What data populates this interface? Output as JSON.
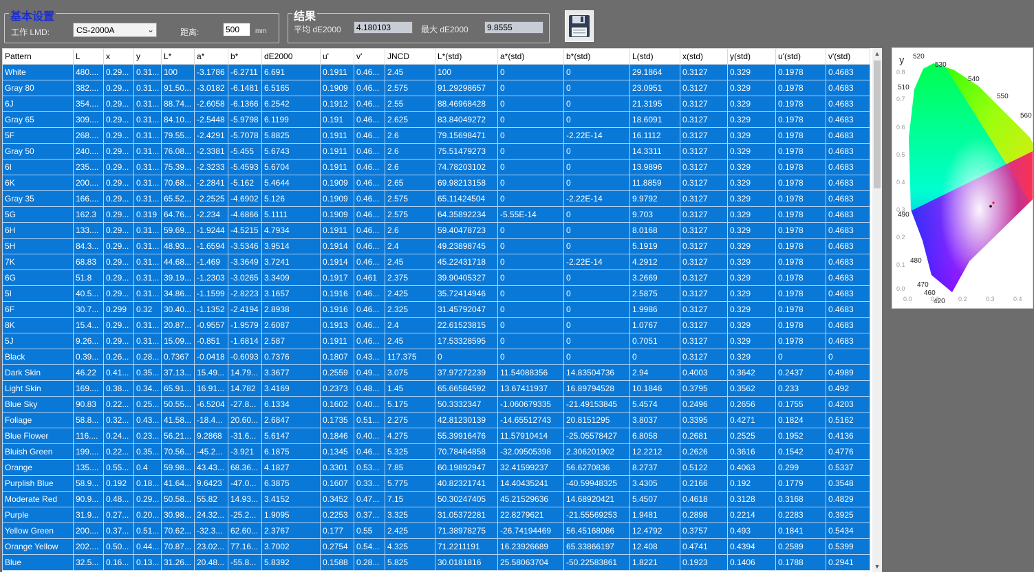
{
  "settings": {
    "title": "基本设置",
    "lmd_label": "工作 LMD:",
    "lmd_value": "CS-2000A",
    "distance_label": "距离:",
    "distance_value": "500",
    "distance_unit": "mm"
  },
  "results": {
    "title": "结果",
    "avg_label": "平均 dE2000",
    "avg_value": "4.180103",
    "max_label": "最大 dE2000",
    "max_value": "9.8555"
  },
  "toolbar": {
    "save_icon": "floppy-disk-icon"
  },
  "colors": {
    "accent_title": "#1c2fd0",
    "row_bg": "#0a78d7",
    "window_bg": "#6d6d6d"
  },
  "table": {
    "columns": [
      "Pattern",
      "L",
      "x",
      "y",
      "L*",
      "a*",
      "b*",
      "dE2000",
      "u'",
      "v'",
      "JNCD",
      "L*(std)",
      "a*(std)",
      "b*(std)",
      "L(std)",
      "x(std)",
      "y(std)",
      "u'(std)",
      "v'(std)"
    ],
    "rows": [
      [
        "White",
        "480....",
        "0.29...",
        "0.31...",
        "100",
        "-3.1786",
        "-6.2711",
        "6.691",
        "0.1911",
        "0.46...",
        "2.45",
        "100",
        "0",
        "0",
        "29.1864",
        "0.3127",
        "0.329",
        "0.1978",
        "0.4683"
      ],
      [
        "Gray 80",
        "382....",
        "0.29...",
        "0.31...",
        "91.50...",
        "-3.0182",
        "-6.1481",
        "6.5165",
        "0.1909",
        "0.46...",
        "2.575",
        "91.29298657",
        "0",
        "0",
        "23.0951",
        "0.3127",
        "0.329",
        "0.1978",
        "0.4683"
      ],
      [
        "6J",
        "354....",
        "0.29...",
        "0.31...",
        "88.74...",
        "-2.6058",
        "-6.1366",
        "6.2542",
        "0.1912",
        "0.46...",
        "2.55",
        "88.46968428",
        "0",
        "0",
        "21.3195",
        "0.3127",
        "0.329",
        "0.1978",
        "0.4683"
      ],
      [
        "Gray 65",
        "309....",
        "0.29...",
        "0.31...",
        "84.10...",
        "-2.5448",
        "-5.9798",
        "6.1199",
        "0.191",
        "0.46...",
        "2.625",
        "83.84049272",
        "0",
        "0",
        "18.6091",
        "0.3127",
        "0.329",
        "0.1978",
        "0.4683"
      ],
      [
        "5F",
        "268....",
        "0.29...",
        "0.31...",
        "79.55...",
        "-2.4291",
        "-5.7078",
        "5.8825",
        "0.1911",
        "0.46...",
        "2.6",
        "79.15698471",
        "0",
        "-2.22E-14",
        "16.1112",
        "0.3127",
        "0.329",
        "0.1978",
        "0.4683"
      ],
      [
        "Gray 50",
        "240....",
        "0.29...",
        "0.31...",
        "76.08...",
        "-2.3381",
        "-5.455",
        "5.6743",
        "0.1911",
        "0.46...",
        "2.6",
        "75.51479273",
        "0",
        "0",
        "14.3311",
        "0.3127",
        "0.329",
        "0.1978",
        "0.4683"
      ],
      [
        "6I",
        "235....",
        "0.29...",
        "0.31...",
        "75.39...",
        "-2.3233",
        "-5.4593",
        "5.6704",
        "0.1911",
        "0.46...",
        "2.6",
        "74.78203102",
        "0",
        "0",
        "13.9896",
        "0.3127",
        "0.329",
        "0.1978",
        "0.4683"
      ],
      [
        "6K",
        "200....",
        "0.29...",
        "0.31...",
        "70.68...",
        "-2.2841",
        "-5.162",
        "5.4644",
        "0.1909",
        "0.46...",
        "2.65",
        "69.98213158",
        "0",
        "0",
        "11.8859",
        "0.3127",
        "0.329",
        "0.1978",
        "0.4683"
      ],
      [
        "Gray 35",
        "166....",
        "0.29...",
        "0.31...",
        "65.52...",
        "-2.2525",
        "-4.6902",
        "5.126",
        "0.1909",
        "0.46...",
        "2.575",
        "65.11424504",
        "0",
        "-2.22E-14",
        "9.9792",
        "0.3127",
        "0.329",
        "0.1978",
        "0.4683"
      ],
      [
        "5G",
        "162.3",
        "0.29...",
        "0.319",
        "64.76...",
        "-2.234",
        "-4.6866",
        "5.1111",
        "0.1909",
        "0.46...",
        "2.575",
        "64.35892234",
        "-5.55E-14",
        "0",
        "9.703",
        "0.3127",
        "0.329",
        "0.1978",
        "0.4683"
      ],
      [
        "6H",
        "133....",
        "0.29...",
        "0.31...",
        "59.69...",
        "-1.9244",
        "-4.5215",
        "4.7934",
        "0.1911",
        "0.46...",
        "2.6",
        "59.40478723",
        "0",
        "0",
        "8.0168",
        "0.3127",
        "0.329",
        "0.1978",
        "0.4683"
      ],
      [
        "5H",
        "84.3...",
        "0.29...",
        "0.31...",
        "48.93...",
        "-1.6594",
        "-3.5346",
        "3.9514",
        "0.1914",
        "0.46...",
        "2.4",
        "49.23898745",
        "0",
        "0",
        "5.1919",
        "0.3127",
        "0.329",
        "0.1978",
        "0.4683"
      ],
      [
        "7K",
        "68.83",
        "0.29...",
        "0.31...",
        "44.68...",
        "-1.469",
        "-3.3649",
        "3.7241",
        "0.1914",
        "0.46...",
        "2.45",
        "45.22431718",
        "0",
        "-2.22E-14",
        "4.2912",
        "0.3127",
        "0.329",
        "0.1978",
        "0.4683"
      ],
      [
        "6G",
        "51.8",
        "0.29...",
        "0.31...",
        "39.19...",
        "-1.2303",
        "-3.0265",
        "3.3409",
        "0.1917",
        "0.461",
        "2.375",
        "39.90405327",
        "0",
        "0",
        "3.2669",
        "0.3127",
        "0.329",
        "0.1978",
        "0.4683"
      ],
      [
        "5I",
        "40.5...",
        "0.29...",
        "0.31...",
        "34.86...",
        "-1.1599",
        "-2.8223",
        "3.1657",
        "0.1916",
        "0.46...",
        "2.425",
        "35.72414946",
        "0",
        "0",
        "2.5875",
        "0.3127",
        "0.329",
        "0.1978",
        "0.4683"
      ],
      [
        "6F",
        "30.7...",
        "0.299",
        "0.32",
        "30.40...",
        "-1.1352",
        "-2.4194",
        "2.8938",
        "0.1916",
        "0.46...",
        "2.325",
        "31.45792047",
        "0",
        "0",
        "1.9986",
        "0.3127",
        "0.329",
        "0.1978",
        "0.4683"
      ],
      [
        "8K",
        "15.4...",
        "0.29...",
        "0.31...",
        "20.87...",
        "-0.9557",
        "-1.9579",
        "2.6087",
        "0.1913",
        "0.46...",
        "2.4",
        "22.61523815",
        "0",
        "0",
        "1.0767",
        "0.3127",
        "0.329",
        "0.1978",
        "0.4683"
      ],
      [
        "5J",
        "9.26...",
        "0.29...",
        "0.31...",
        "15.09...",
        "-0.851",
        "-1.6814",
        "2.587",
        "0.1911",
        "0.46...",
        "2.45",
        "17.53328595",
        "0",
        "0",
        "0.7051",
        "0.3127",
        "0.329",
        "0.1978",
        "0.4683"
      ],
      [
        "Black",
        "0.39...",
        "0.26...",
        "0.28...",
        "0.7367",
        "-0.0418",
        "-0.6093",
        "0.7376",
        "0.1807",
        "0.43...",
        "117.375",
        "0",
        "0",
        "0",
        "0",
        "0.3127",
        "0.329",
        "0",
        "0"
      ],
      [
        "Dark Skin",
        "46.22",
        "0.41...",
        "0.35...",
        "37.13...",
        "15.49...",
        "14.79...",
        "3.3677",
        "0.2559",
        "0.49...",
        "3.075",
        "37.97272239",
        "11.54088356",
        "14.83504736",
        "2.94",
        "0.4003",
        "0.3642",
        "0.2437",
        "0.4989"
      ],
      [
        "Light Skin",
        "169....",
        "0.38...",
        "0.34...",
        "65.91...",
        "16.91...",
        "14.782",
        "3.4169",
        "0.2373",
        "0.48...",
        "1.45",
        "65.66584592",
        "13.67411937",
        "16.89794528",
        "10.1846",
        "0.3795",
        "0.3562",
        "0.233",
        "0.492"
      ],
      [
        "Blue Sky",
        "90.83",
        "0.22...",
        "0.25...",
        "50.55...",
        "-6.5204",
        "-27.8...",
        "6.1334",
        "0.1602",
        "0.40...",
        "5.175",
        "50.3332347",
        "-1.060679335",
        "-21.49153845",
        "5.4574",
        "0.2496",
        "0.2656",
        "0.1755",
        "0.4203"
      ],
      [
        "Foliage",
        "58.8...",
        "0.32...",
        "0.43...",
        "41.58...",
        "-18.4...",
        "20.60...",
        "2.6847",
        "0.1735",
        "0.51...",
        "2.275",
        "42.81230139",
        "-14.65512743",
        "20.8151295",
        "3.8037",
        "0.3395",
        "0.4271",
        "0.1824",
        "0.5162"
      ],
      [
        "Blue Flower",
        "116....",
        "0.24...",
        "0.23...",
        "56.21...",
        "9.2868",
        "-31.6...",
        "5.6147",
        "0.1846",
        "0.40...",
        "4.275",
        "55.39916476",
        "11.57910414",
        "-25.05578427",
        "6.8058",
        "0.2681",
        "0.2525",
        "0.1952",
        "0.4136"
      ],
      [
        "Bluish Green",
        "199....",
        "0.22...",
        "0.35...",
        "70.56...",
        "-45.2...",
        "-3.921",
        "6.1875",
        "0.1345",
        "0.46...",
        "5.325",
        "70.78464858",
        "-32.09505398",
        "2.306201902",
        "12.2212",
        "0.2626",
        "0.3616",
        "0.1542",
        "0.4776"
      ],
      [
        "Orange",
        "135....",
        "0.55...",
        "0.4",
        "59.98...",
        "43.43...",
        "68.36...",
        "4.1827",
        "0.3301",
        "0.53...",
        "7.85",
        "60.19892947",
        "32.41599237",
        "56.6270836",
        "8.2737",
        "0.5122",
        "0.4063",
        "0.299",
        "0.5337"
      ],
      [
        "Purplish Blue",
        "58.9...",
        "0.192",
        "0.18...",
        "41.64...",
        "9.6423",
        "-47.0...",
        "6.3875",
        "0.1607",
        "0.33...",
        "5.775",
        "40.82321741",
        "14.40435241",
        "-40.59948325",
        "3.4305",
        "0.2166",
        "0.192",
        "0.1779",
        "0.3548"
      ],
      [
        "Moderate Red",
        "90.9...",
        "0.48...",
        "0.29...",
        "50.58...",
        "55.82",
        "14.93...",
        "3.4152",
        "0.3452",
        "0.47...",
        "7.15",
        "50.30247405",
        "45.21529636",
        "14.68920421",
        "5.4507",
        "0.4618",
        "0.3128",
        "0.3168",
        "0.4829"
      ],
      [
        "Purple",
        "31.9...",
        "0.27...",
        "0.20...",
        "30.98...",
        "24.32...",
        "-25.2...",
        "1.9095",
        "0.2253",
        "0.37...",
        "3.325",
        "31.05372281",
        "22.8279621",
        "-21.55569253",
        "1.9481",
        "0.2898",
        "0.2214",
        "0.2283",
        "0.3925"
      ],
      [
        "Yellow Green",
        "200....",
        "0.37...",
        "0.51...",
        "70.62...",
        "-32.3...",
        "62.60...",
        "2.3767",
        "0.177",
        "0.55",
        "2.425",
        "71.38978275",
        "-26.74194469",
        "56.45168086",
        "12.4792",
        "0.3757",
        "0.493",
        "0.1841",
        "0.5434"
      ],
      [
        "Orange Yellow",
        "202....",
        "0.50...",
        "0.44...",
        "70.87...",
        "23.02...",
        "77.16...",
        "3.7002",
        "0.2754",
        "0.54...",
        "4.325",
        "71.2211191",
        "16.23926689",
        "65.33866197",
        "12.408",
        "0.4741",
        "0.4394",
        "0.2589",
        "0.5399"
      ],
      [
        "Blue",
        "32.5...",
        "0.16...",
        "0.13...",
        "31.26...",
        "20.48...",
        "-55.8...",
        "5.8392",
        "0.1588",
        "0.28...",
        "5.825",
        "30.0181816",
        "25.58063704",
        "-50.22583861",
        "1.8221",
        "0.1923",
        "0.1406",
        "0.1788",
        "0.2941"
      ]
    ]
  },
  "cie": {
    "axis_y_label": "y",
    "y_ticks": [
      "0.8",
      "0.7",
      "0.6",
      "0.5",
      "0.4",
      "0.3",
      "0.2",
      "0.1",
      "0.0"
    ],
    "x_ticks": [
      "0.0",
      "0.1",
      "0.2",
      "0.3",
      "0.4"
    ],
    "wavelengths": [
      "520",
      "530",
      "540",
      "550",
      "560",
      "510",
      "490",
      "480",
      "470",
      "460",
      "420"
    ]
  }
}
